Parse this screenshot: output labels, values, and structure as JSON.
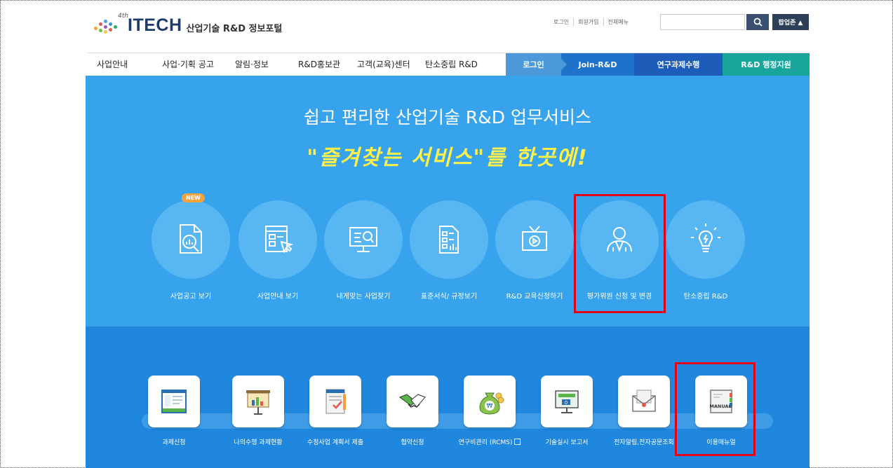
{
  "header": {
    "logo_badge": "4th",
    "logo_main": "ITECH",
    "logo_sub": "산업기술 R&D 정보포털",
    "links": [
      "로그인",
      "회원가입",
      "전체메뉴"
    ],
    "search_placeholder": "",
    "popup_label": "팝업존 ▲"
  },
  "nav": {
    "items": [
      "사업안내",
      "사업·기획 공고",
      "알림·정보",
      "R&D홍보관",
      "고객(교육)센터",
      "탄소중립 R&D"
    ],
    "right": [
      "로그인",
      "Join-R&D",
      "연구과제수행",
      "R&D 행정지원"
    ]
  },
  "hero": {
    "title": "쉽고 편리한 산업기술 R&D 업무서비스",
    "slogan": "\"즐겨찾는 서비스\"를 한곳에!",
    "new_badge": "NEW",
    "services": [
      {
        "label": "사업공고 보기",
        "icon": "document-search-icon"
      },
      {
        "label": "사업안내 보기",
        "icon": "form-click-icon"
      },
      {
        "label": "내게맞는 사업찾기",
        "icon": "monitor-search-icon"
      },
      {
        "label": "표준서식/ 규정보기",
        "icon": "document-chart-icon"
      },
      {
        "label": "R&D 교육신청하기",
        "icon": "tv-play-icon"
      },
      {
        "label": "평가위원 신청 및 변경",
        "icon": "person-suit-icon"
      },
      {
        "label": "탄소중립 R&D",
        "icon": "lightbulb-icon"
      }
    ]
  },
  "tools": [
    {
      "label": "과제신청",
      "icon": "window-app-icon"
    },
    {
      "label": "나의수행 과제현황",
      "icon": "presentation-chart-icon"
    },
    {
      "label": "수정사업 계획서 제출",
      "icon": "checklist-icon"
    },
    {
      "label": "협약신청",
      "icon": "handshake-icon"
    },
    {
      "label": "연구비관리 (RCMS)",
      "icon": "money-bag-icon"
    },
    {
      "label": "기술실시 보고서",
      "icon": "monitor-report-icon"
    },
    {
      "label": "전자알림,전자공문조회",
      "icon": "envelope-icon"
    },
    {
      "label": "이용매뉴얼",
      "icon": "manual-book-icon"
    }
  ],
  "manual_text": "MANUAL",
  "colors": {
    "hero_bg": "#36a3ec",
    "circle": "#58b7f3",
    "slogan": "#fdf04a",
    "band_bg": "#2087de",
    "highlight": "#e5001a"
  }
}
